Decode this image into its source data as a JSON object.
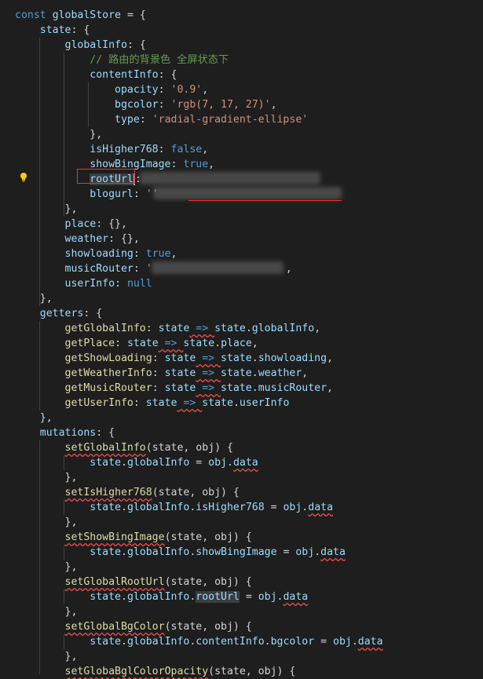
{
  "code": {
    "l1": [
      "const",
      "globalStore",
      "= {"
    ],
    "l2": [
      "state",
      ": {"
    ],
    "l3": [
      "globalInfo",
      ": {"
    ],
    "l4": "// 路由的背景色 全屏状态下",
    "l5": [
      "contentInfo",
      ": {"
    ],
    "l6": [
      "opacity",
      ": ",
      "'0.9'",
      ","
    ],
    "l7": [
      "bgcolor",
      ": ",
      "'rgb(7, 17, 27)'",
      ","
    ],
    "l8": [
      "type",
      ": ",
      "'radial-gradient-ellipse'"
    ],
    "l9": "},",
    "l10": [
      "isHigher768",
      ": ",
      "false",
      ","
    ],
    "l11": [
      "showBingImage",
      ": ",
      "true",
      ","
    ],
    "l12": [
      "rootUrl",
      ":"
    ],
    "l13": [
      "blogurl",
      ": ",
      "''"
    ],
    "l14": "},",
    "l15": [
      "place",
      ": {},"
    ],
    "l16": [
      "weather",
      ": {},"
    ],
    "l17": [
      "showloading",
      ": ",
      "true",
      ","
    ],
    "l18": [
      "musicRouter",
      ": ",
      "'",
      ","
    ],
    "l19": [
      "userInfo",
      ": ",
      "null"
    ],
    "l20": "},",
    "l21": [
      "getters",
      ": {"
    ],
    "l22": [
      "getGlobalInfo",
      ": ",
      "state",
      " => ",
      "state",
      ".",
      "globalInfo",
      ","
    ],
    "l23": [
      "getPlace",
      ": ",
      "state",
      " => ",
      "state",
      ".",
      "place",
      ","
    ],
    "l24": [
      "getShowLoading",
      ": ",
      "state",
      " => ",
      "state",
      ".",
      "showloading",
      ","
    ],
    "l25": [
      "getWeatherInfo",
      ": ",
      "state",
      " => ",
      "state",
      ".",
      "weather",
      ","
    ],
    "l26": [
      "getMusicRouter",
      ": ",
      "state",
      " => ",
      "state",
      ".",
      "musicRouter",
      ","
    ],
    "l27": [
      "getUserInfo",
      ": ",
      "state",
      " => ",
      "state",
      ".",
      "userInfo"
    ],
    "l28": "},",
    "l29": [
      "mutations",
      ": {"
    ],
    "l30": [
      "setGlobalInfo",
      "(state, obj) {"
    ],
    "l31": [
      "state",
      ".",
      "globalInfo",
      " = ",
      "obj",
      ".",
      "data"
    ],
    "l32": "},",
    "l33": [
      "setIsHigher768",
      "(state, obj) {"
    ],
    "l34": [
      "state",
      ".",
      "globalInfo",
      ".",
      "isHigher768",
      " = ",
      "obj",
      ".",
      "data"
    ],
    "l35": "},",
    "l36": [
      "setShowBingImage",
      "(state, obj) {"
    ],
    "l37": [
      "state",
      ".",
      "globalInfo",
      ".",
      "showBingImage",
      " = ",
      "obj",
      ".",
      "data"
    ],
    "l38": "},",
    "l39": [
      "setGlobalRootUrl",
      "(state, obj) {"
    ],
    "l40": [
      "state",
      ".",
      "globalInfo",
      ".",
      "rootUrl",
      " = ",
      "obj",
      ".",
      "data"
    ],
    "l41": "},",
    "l42": [
      "setGlobalBgColor",
      "(state, obj) {"
    ],
    "l43": [
      "state",
      ".",
      "globalInfo",
      ".",
      "contentInfo",
      ".",
      "bgcolor",
      " = ",
      "obj",
      ".",
      "data"
    ],
    "l44": "},",
    "l45": [
      "setGlobaBglColorOpacity",
      "(state, obj) {"
    ]
  },
  "colors": {
    "background": "#1e1e1e",
    "keyword": "#569cd6",
    "property": "#9cdcfe",
    "string": "#ce9178",
    "function": "#dcdcaa",
    "comment": "#6a9955",
    "selection_border": "#e0353b"
  },
  "icons": {
    "lightbulb": "lightbulb-icon"
  }
}
